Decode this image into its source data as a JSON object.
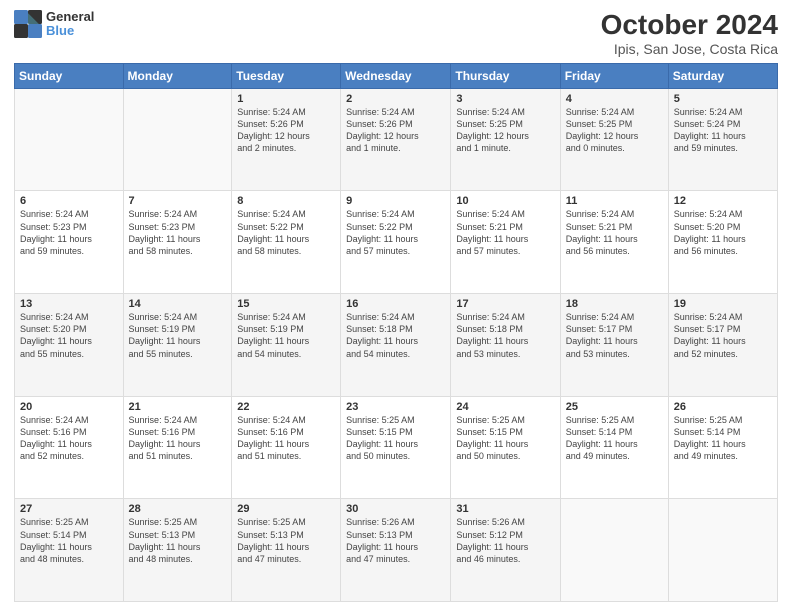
{
  "header": {
    "logo_line1": "General",
    "logo_line2": "Blue",
    "title": "October 2024",
    "subtitle": "Ipis, San Jose, Costa Rica"
  },
  "days_of_week": [
    "Sunday",
    "Monday",
    "Tuesday",
    "Wednesday",
    "Thursday",
    "Friday",
    "Saturday"
  ],
  "weeks": [
    [
      {
        "day": "",
        "info": ""
      },
      {
        "day": "",
        "info": ""
      },
      {
        "day": "1",
        "info": "Sunrise: 5:24 AM\nSunset: 5:26 PM\nDaylight: 12 hours\nand 2 minutes."
      },
      {
        "day": "2",
        "info": "Sunrise: 5:24 AM\nSunset: 5:26 PM\nDaylight: 12 hours\nand 1 minute."
      },
      {
        "day": "3",
        "info": "Sunrise: 5:24 AM\nSunset: 5:25 PM\nDaylight: 12 hours\nand 1 minute."
      },
      {
        "day": "4",
        "info": "Sunrise: 5:24 AM\nSunset: 5:25 PM\nDaylight: 12 hours\nand 0 minutes."
      },
      {
        "day": "5",
        "info": "Sunrise: 5:24 AM\nSunset: 5:24 PM\nDaylight: 11 hours\nand 59 minutes."
      }
    ],
    [
      {
        "day": "6",
        "info": "Sunrise: 5:24 AM\nSunset: 5:23 PM\nDaylight: 11 hours\nand 59 minutes."
      },
      {
        "day": "7",
        "info": "Sunrise: 5:24 AM\nSunset: 5:23 PM\nDaylight: 11 hours\nand 58 minutes."
      },
      {
        "day": "8",
        "info": "Sunrise: 5:24 AM\nSunset: 5:22 PM\nDaylight: 11 hours\nand 58 minutes."
      },
      {
        "day": "9",
        "info": "Sunrise: 5:24 AM\nSunset: 5:22 PM\nDaylight: 11 hours\nand 57 minutes."
      },
      {
        "day": "10",
        "info": "Sunrise: 5:24 AM\nSunset: 5:21 PM\nDaylight: 11 hours\nand 57 minutes."
      },
      {
        "day": "11",
        "info": "Sunrise: 5:24 AM\nSunset: 5:21 PM\nDaylight: 11 hours\nand 56 minutes."
      },
      {
        "day": "12",
        "info": "Sunrise: 5:24 AM\nSunset: 5:20 PM\nDaylight: 11 hours\nand 56 minutes."
      }
    ],
    [
      {
        "day": "13",
        "info": "Sunrise: 5:24 AM\nSunset: 5:20 PM\nDaylight: 11 hours\nand 55 minutes."
      },
      {
        "day": "14",
        "info": "Sunrise: 5:24 AM\nSunset: 5:19 PM\nDaylight: 11 hours\nand 55 minutes."
      },
      {
        "day": "15",
        "info": "Sunrise: 5:24 AM\nSunset: 5:19 PM\nDaylight: 11 hours\nand 54 minutes."
      },
      {
        "day": "16",
        "info": "Sunrise: 5:24 AM\nSunset: 5:18 PM\nDaylight: 11 hours\nand 54 minutes."
      },
      {
        "day": "17",
        "info": "Sunrise: 5:24 AM\nSunset: 5:18 PM\nDaylight: 11 hours\nand 53 minutes."
      },
      {
        "day": "18",
        "info": "Sunrise: 5:24 AM\nSunset: 5:17 PM\nDaylight: 11 hours\nand 53 minutes."
      },
      {
        "day": "19",
        "info": "Sunrise: 5:24 AM\nSunset: 5:17 PM\nDaylight: 11 hours\nand 52 minutes."
      }
    ],
    [
      {
        "day": "20",
        "info": "Sunrise: 5:24 AM\nSunset: 5:16 PM\nDaylight: 11 hours\nand 52 minutes."
      },
      {
        "day": "21",
        "info": "Sunrise: 5:24 AM\nSunset: 5:16 PM\nDaylight: 11 hours\nand 51 minutes."
      },
      {
        "day": "22",
        "info": "Sunrise: 5:24 AM\nSunset: 5:16 PM\nDaylight: 11 hours\nand 51 minutes."
      },
      {
        "day": "23",
        "info": "Sunrise: 5:25 AM\nSunset: 5:15 PM\nDaylight: 11 hours\nand 50 minutes."
      },
      {
        "day": "24",
        "info": "Sunrise: 5:25 AM\nSunset: 5:15 PM\nDaylight: 11 hours\nand 50 minutes."
      },
      {
        "day": "25",
        "info": "Sunrise: 5:25 AM\nSunset: 5:14 PM\nDaylight: 11 hours\nand 49 minutes."
      },
      {
        "day": "26",
        "info": "Sunrise: 5:25 AM\nSunset: 5:14 PM\nDaylight: 11 hours\nand 49 minutes."
      }
    ],
    [
      {
        "day": "27",
        "info": "Sunrise: 5:25 AM\nSunset: 5:14 PM\nDaylight: 11 hours\nand 48 minutes."
      },
      {
        "day": "28",
        "info": "Sunrise: 5:25 AM\nSunset: 5:13 PM\nDaylight: 11 hours\nand 48 minutes."
      },
      {
        "day": "29",
        "info": "Sunrise: 5:25 AM\nSunset: 5:13 PM\nDaylight: 11 hours\nand 47 minutes."
      },
      {
        "day": "30",
        "info": "Sunrise: 5:26 AM\nSunset: 5:13 PM\nDaylight: 11 hours\nand 47 minutes."
      },
      {
        "day": "31",
        "info": "Sunrise: 5:26 AM\nSunset: 5:12 PM\nDaylight: 11 hours\nand 46 minutes."
      },
      {
        "day": "",
        "info": ""
      },
      {
        "day": "",
        "info": ""
      }
    ]
  ]
}
